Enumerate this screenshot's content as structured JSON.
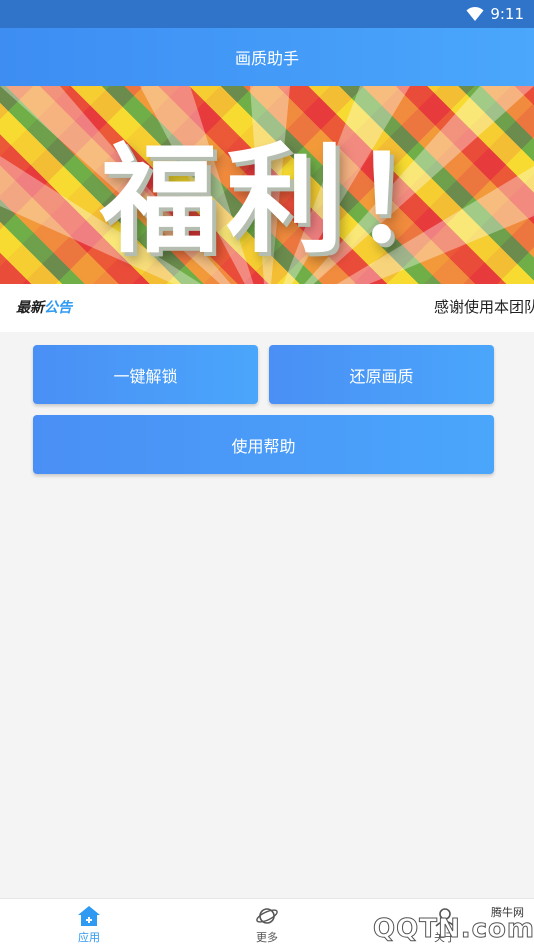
{
  "status_bar": {
    "time": "9:11"
  },
  "app_bar": {
    "title": "画质助手"
  },
  "banner": {
    "text": "福利！"
  },
  "notice": {
    "tag_part1": "最新",
    "tag_part2": "公告",
    "text": "感谢使用本团队"
  },
  "actions": {
    "unlock_label": "一键解锁",
    "restore_label": "还原画质",
    "help_label": "使用帮助"
  },
  "bottom_nav": {
    "items": [
      {
        "label": "应用",
        "icon": "home-icon",
        "active": true
      },
      {
        "label": "更多",
        "icon": "planet-icon",
        "active": false
      },
      {
        "label": "关于",
        "icon": "info-icon",
        "active": false
      }
    ]
  },
  "watermark": {
    "site": "腾牛网",
    "logo": "QQTN.com"
  },
  "colors": {
    "accent": "#3d8df3",
    "status_bar": "#2f74c9",
    "tag_blue": "#2e9af2"
  }
}
